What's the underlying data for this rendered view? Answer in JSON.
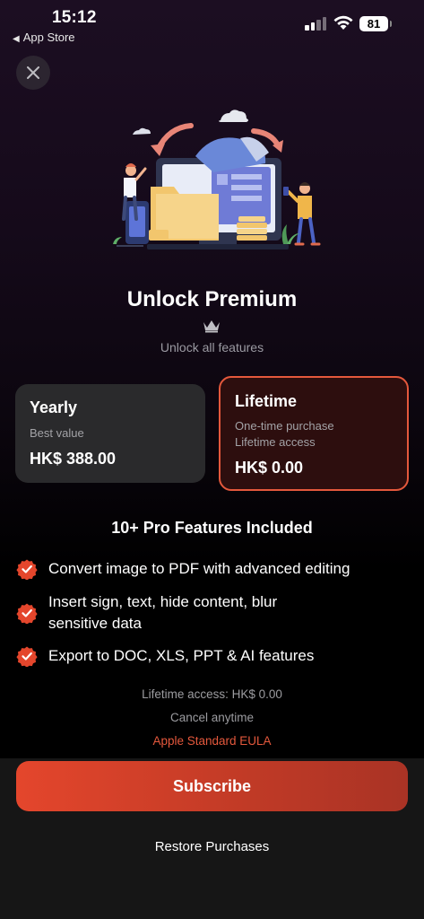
{
  "status_bar": {
    "time": "15:12",
    "back_app": "App Store",
    "battery": "81"
  },
  "header": {
    "close_icon": "close-icon"
  },
  "hero": {
    "illustration": "file-transfer-illustration"
  },
  "title": "Unlock Premium",
  "crown_icon": "crown-icon",
  "subtitle": "Unlock all features",
  "plans": [
    {
      "name": "Yearly",
      "desc_line1": "Best value",
      "desc_line2": "",
      "price": "HK$ 388.00",
      "selected": false
    },
    {
      "name": "Lifetime",
      "desc_line1": "One-time purchase",
      "desc_line2": "Lifetime access",
      "price": "HK$ 0.00",
      "selected": true
    }
  ],
  "features": {
    "title": "10+ Pro Features Included",
    "items": [
      "Convert image to PDF with advanced editing",
      "Insert sign, text, hide content, blur sensitive data",
      "Export to DOC, XLS, PPT & AI features"
    ]
  },
  "footer": {
    "access_note": "Lifetime access: HK$ 0.00",
    "cancel_note": "Cancel anytime",
    "eula_link": "Apple Standard EULA"
  },
  "actions": {
    "subscribe": "Subscribe",
    "restore": "Restore Purchases"
  },
  "colors": {
    "accent": "#e4583c",
    "card_dark": "#2a2a2c",
    "card_selected": "#2d0e0e"
  }
}
